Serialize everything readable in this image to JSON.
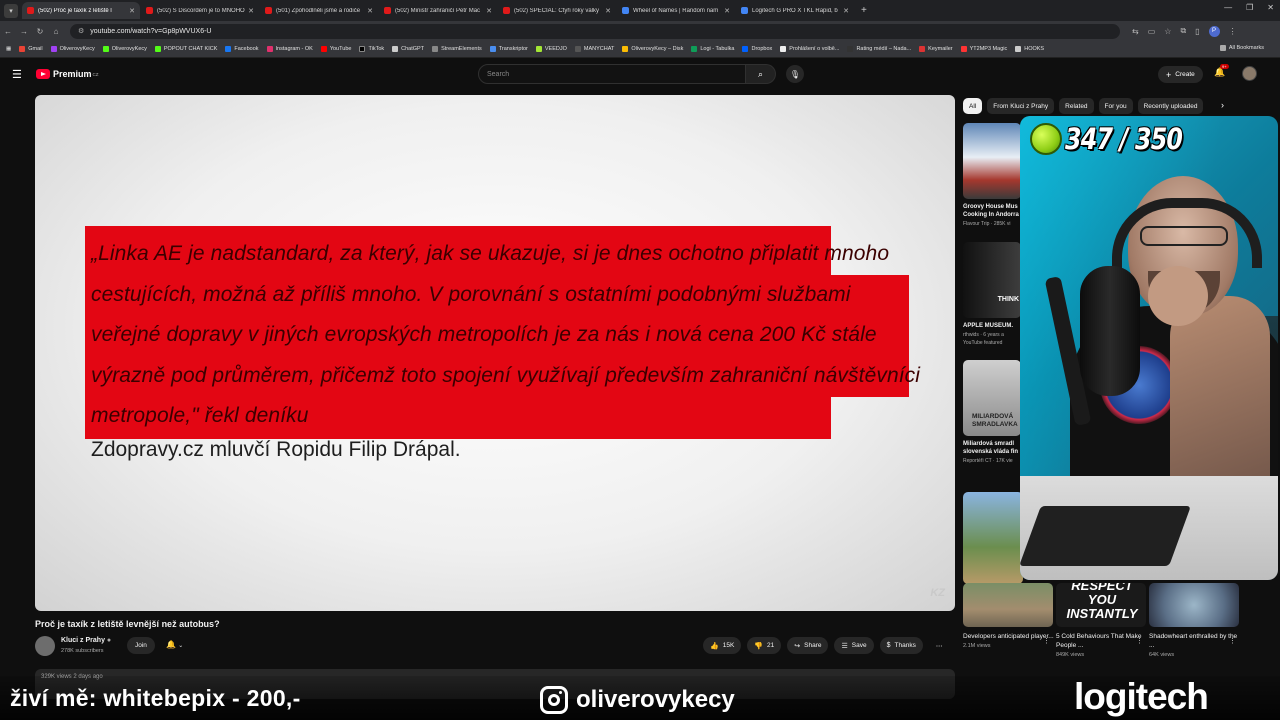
{
  "browser": {
    "tabs": [
      {
        "title": "(502) Proč je taxík z letiště l",
        "active": true,
        "icon": "youtube-icon"
      },
      {
        "title": "(502) S Discordem je to MNOHO",
        "active": false,
        "icon": "youtube-icon"
      },
      {
        "title": "(501) Zpohodlněli jsme a rodiče",
        "active": false,
        "icon": "youtube-icon"
      },
      {
        "title": "(502) Ministr zahraničí Petr Mac",
        "active": false,
        "icon": "youtube-icon"
      },
      {
        "title": "(502) SPECIÁL: Čtyři roky války",
        "active": false,
        "icon": "youtube-icon"
      },
      {
        "title": "Wheel of Names | Random nam",
        "active": false,
        "icon": "wheel-icon"
      },
      {
        "title": "Logitech G PRO X TKL Rapid, b",
        "active": false,
        "icon": "logitech-icon"
      }
    ],
    "url": "youtube.com/watch?v=Gp8pWVUX6-U",
    "profile_initial": "P",
    "bookmarks": [
      "Gmail",
      "OliverovyKecy",
      "OliverovyKecy",
      "POPOUT CHAT KICK",
      "Facebook",
      "Instagram - OK",
      "YouTube",
      "TikTok",
      "ChatGPT",
      "StreamElements",
      "Transkriptor",
      "VEEDJO",
      "MANYCHAT",
      "OliverovyKecy – Disk",
      "Logi - Tabulka",
      "Dropbox",
      "Prohlášení o volbě...",
      "Rating médií – Nada...",
      "Keymailer",
      "YT2MP3 Magic",
      "HOOKS"
    ],
    "all_bookmarks": "All Bookmarks"
  },
  "youtube": {
    "logo_text": "Premium",
    "logo_country": "CZ",
    "search_placeholder": "Search",
    "create_label": "Create",
    "notif_badge": "9+"
  },
  "video": {
    "quote_text": "„Linka AE je nadstandard, za který, jak se ukazuje, si je dnes ochotno připlatit mnoho cestujících, možná až příliš mnoho. V porovnání s ostatními podobnými službami veřejné dopravy v jiných evropských metropolích je za nás i nová cena 200 Kč stále výrazně pod průměrem, přičemž toto spojení využívají především zahraniční návštěvníci metropole,\" řekl deníku",
    "quote_source": "Zdopravy.cz mluvčí Ropidu Filip Drápal.",
    "watermark": "KZ",
    "title": "Proč je taxík z letiště levnější než autobus?",
    "channel": "Kluci z Prahy",
    "subscribers": "278K subscribers",
    "join_label": "Join",
    "likes": "15K",
    "dislikes": "21",
    "share_label": "Share",
    "save_label": "Save",
    "thanks_label": "Thanks",
    "views_line": "329K views  2 days ago"
  },
  "sidebar": {
    "chips": [
      "All",
      "From Kluci z Prahy",
      "Related",
      "For you",
      "Recently uploaded"
    ],
    "videos": [
      {
        "title": "Groovy House Mus",
        "title2": "Cooking In Andorra",
        "meta": "Flavour Trip · 285K vi"
      },
      {
        "title": "APPLE MUSEUM.",
        "title2": "",
        "meta": "rthwids · 6 years a",
        "meta2": "YouTube featured",
        "thumb_text": "THINK"
      },
      {
        "title": "Miliardová smradl",
        "title2": "slovenská vláda fin",
        "meta": "Reportéři ČT · 17K vie",
        "thumb_text": "MILIARDOVÁ SMRADLAVKA"
      }
    ],
    "shorts": [
      {
        "title": "Developers anticipated player...",
        "views": "2.1M views"
      },
      {
        "title": "5 Cold Behaviours That Make People ...",
        "views": "849K views",
        "thumb_text": "RESPECT YOU INSTANTLY"
      },
      {
        "title": "Shadowheart enthralled by the ...",
        "views": "64K views"
      }
    ]
  },
  "stream_overlay": {
    "counter": "347 / 350",
    "donate_text": "živí mě: whitebepix - 200,-",
    "instagram": "oliverovykecy",
    "sponsor": "logitech"
  }
}
